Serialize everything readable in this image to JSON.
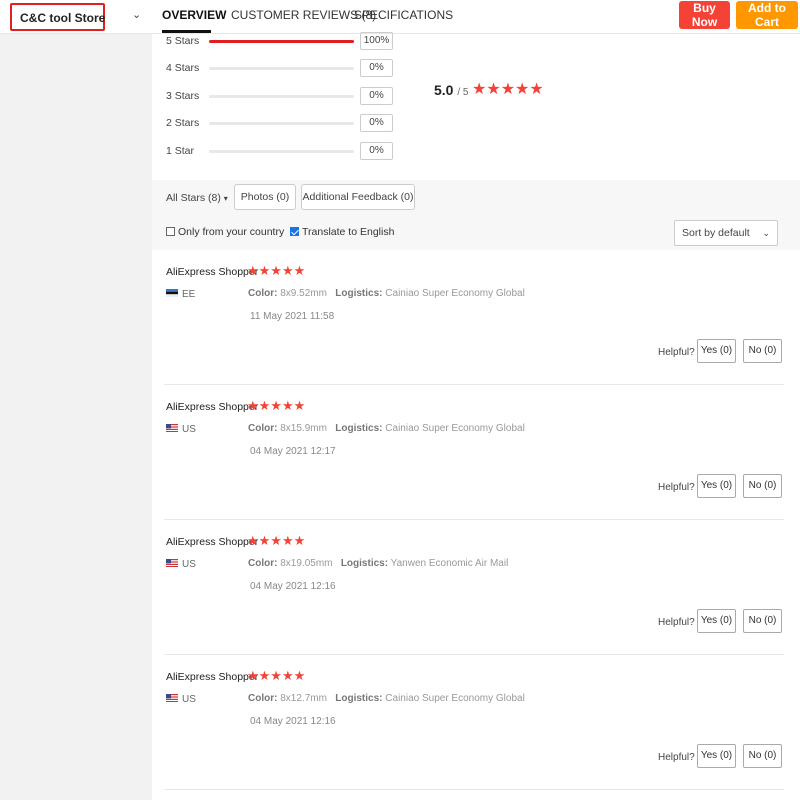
{
  "header": {
    "store_name": "C&C tool Store",
    "tabs": [
      "OVERVIEW",
      "CUSTOMER REVIEWS (8)",
      "SPECIFICATIONS"
    ],
    "buy_now": "Buy Now",
    "add_to_cart": "Add to Cart",
    "colors": {
      "buy": "#f44336",
      "cart": "#ff9800",
      "highlight": "#e02020"
    }
  },
  "ratings": {
    "rows": [
      {
        "label": "5 Stars",
        "percent": "100%",
        "fill": 1.0
      },
      {
        "label": "4 Stars",
        "percent": "0%",
        "fill": 0
      },
      {
        "label": "3 Stars",
        "percent": "0%",
        "fill": 0
      },
      {
        "label": "2 Stars",
        "percent": "0%",
        "fill": 0
      },
      {
        "label": "1 Star",
        "percent": "0%",
        "fill": 0
      }
    ],
    "average": "5.0",
    "out_of": "/ 5",
    "stars": "★★★★★"
  },
  "filters": {
    "all_stars": "All Stars (8)",
    "photos": "Photos (0)",
    "additional": "Additional Feedback (0)",
    "only_country": "Only from your country",
    "translate": "Translate to English",
    "sort": "Sort by default"
  },
  "reviews": [
    {
      "name": "AliExpress Shopper",
      "stars": "★★★★★",
      "country": "EE",
      "color_label": "Color:",
      "color": "8x9.52mm",
      "logistics_label": "Logistics:",
      "logistics": "Cainiao Super Economy Global",
      "date": "11 May 2021 11:58",
      "helpful": "Helpful?",
      "yes": "Yes (0)",
      "no": "No (0)"
    },
    {
      "name": "AliExpress Shopper",
      "stars": "★★★★★",
      "country": "US",
      "color_label": "Color:",
      "color": "8x15.9mm",
      "logistics_label": "Logistics:",
      "logistics": "Cainiao Super Economy Global",
      "date": "04 May 2021 12:17",
      "helpful": "Helpful?",
      "yes": "Yes (0)",
      "no": "No (0)"
    },
    {
      "name": "AliExpress Shopper",
      "stars": "★★★★★",
      "country": "US",
      "color_label": "Color:",
      "color": "8x19.05mm",
      "logistics_label": "Logistics:",
      "logistics": "Yanwen Economic Air Mail",
      "date": "04 May 2021 12:16",
      "helpful": "Helpful?",
      "yes": "Yes (0)",
      "no": "No (0)"
    },
    {
      "name": "AliExpress Shopper",
      "stars": "★★★★★",
      "country": "US",
      "color_label": "Color:",
      "color": "8x12.7mm",
      "logistics_label": "Logistics:",
      "logistics": "Cainiao Super Economy Global",
      "date": "04 May 2021 12:16",
      "helpful": "Helpful?",
      "yes": "Yes (0)",
      "no": "No (0)"
    }
  ]
}
